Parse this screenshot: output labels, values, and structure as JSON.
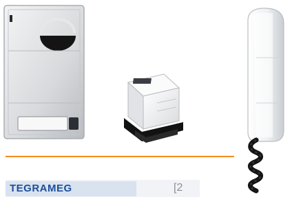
{
  "colors": {
    "background": "#ffffff",
    "divider": "#f28a1e",
    "brand_blue": "#1c4f9a",
    "panel_silver": "#d8dadd",
    "handset_white": "#f4f5f6",
    "cord_black": "#151515"
  },
  "brand": {
    "logo_text": "TEGRAMEG",
    "number": "[2"
  }
}
